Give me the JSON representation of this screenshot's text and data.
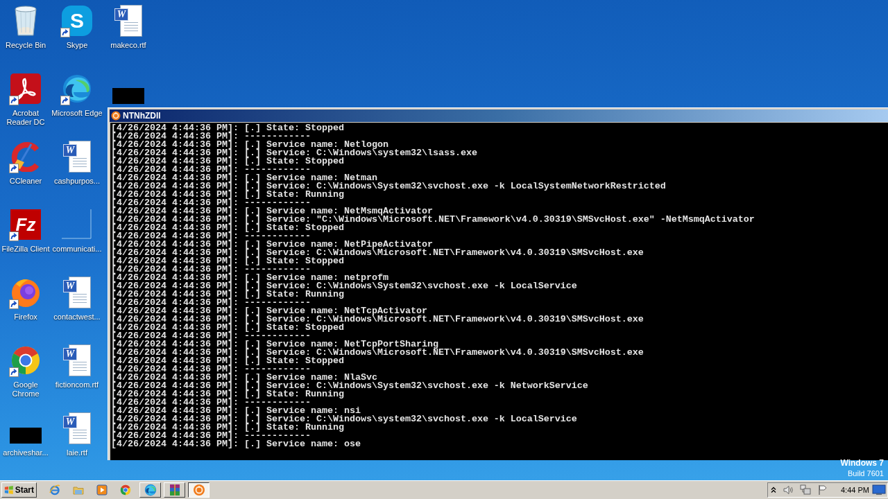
{
  "desktop": {
    "icon_columns": [
      [
        {
          "kind": "recycle-bin",
          "label": "Recycle Bin",
          "shortcut": false
        },
        {
          "kind": "acrobat",
          "label": "Acrobat Reader DC",
          "shortcut": true
        },
        {
          "kind": "ccleaner",
          "label": "CCleaner",
          "shortcut": true
        },
        {
          "kind": "filezilla",
          "label": "FileZilla Client",
          "logo_text": "Fz",
          "shortcut": true
        },
        {
          "kind": "firefox",
          "label": "Firefox",
          "shortcut": true
        },
        {
          "kind": "chrome",
          "label": "Google Chrome",
          "shortcut": true
        },
        {
          "kind": "redacted",
          "label": "archiveshar...",
          "shortcut": false
        }
      ],
      [
        {
          "kind": "skype",
          "label": "Skype",
          "logo_text": "S",
          "shortcut": true
        },
        {
          "kind": "edge",
          "label": "Microsoft Edge",
          "shortcut": true
        },
        {
          "kind": "word",
          "label": "cashpurpos...",
          "logo_text": "W",
          "shortcut": false
        },
        {
          "kind": "blank",
          "label": "communicati...",
          "shortcut": false
        },
        {
          "kind": "word",
          "label": "contactwest...",
          "logo_text": "W",
          "shortcut": false
        },
        {
          "kind": "word",
          "label": "fictioncom.rtf",
          "logo_text": "W",
          "shortcut": false
        },
        {
          "kind": "word",
          "label": "laie.rtf",
          "logo_text": "W",
          "shortcut": false
        }
      ],
      [
        {
          "kind": "word",
          "label": "makeco.rtf",
          "logo_text": "W",
          "shortcut": false
        },
        {
          "kind": "redacted",
          "shortcut": false
        }
      ]
    ],
    "os_edition": "Windows 7",
    "os_build": "Build 7601"
  },
  "console_window": {
    "title": "NTNhZDll",
    "lines": [
      "[4/26/2024 4:44:36 PM]: [.] State: Stopped",
      "[4/26/2024 4:44:36 PM]: ------------",
      "[4/26/2024 4:44:36 PM]: [.] Service name: Netlogon",
      "[4/26/2024 4:44:36 PM]: [.] Service: C:\\Windows\\system32\\lsass.exe",
      "[4/26/2024 4:44:36 PM]: [.] State: Stopped",
      "[4/26/2024 4:44:36 PM]: ------------",
      "[4/26/2024 4:44:36 PM]: [.] Service name: Netman",
      "[4/26/2024 4:44:36 PM]: [.] Service: C:\\Windows\\System32\\svchost.exe -k LocalSystemNetworkRestricted",
      "[4/26/2024 4:44:36 PM]: [.] State: Running",
      "[4/26/2024 4:44:36 PM]: ------------",
      "[4/26/2024 4:44:36 PM]: [.] Service name: NetMsmqActivator",
      "[4/26/2024 4:44:36 PM]: [.] Service: \"C:\\Windows\\Microsoft.NET\\Framework\\v4.0.30319\\SMSvcHost.exe\" -NetMsmqActivator",
      "[4/26/2024 4:44:36 PM]: [.] State: Stopped",
      "[4/26/2024 4:44:36 PM]: ------------",
      "[4/26/2024 4:44:36 PM]: [.] Service name: NetPipeActivator",
      "[4/26/2024 4:44:36 PM]: [.] Service: C:\\Windows\\Microsoft.NET\\Framework\\v4.0.30319\\SMSvcHost.exe",
      "[4/26/2024 4:44:36 PM]: [.] State: Stopped",
      "[4/26/2024 4:44:36 PM]: ------------",
      "[4/26/2024 4:44:36 PM]: [.] Service name: netprofm",
      "[4/26/2024 4:44:36 PM]: [.] Service: C:\\Windows\\System32\\svchost.exe -k LocalService",
      "[4/26/2024 4:44:36 PM]: [.] State: Running",
      "[4/26/2024 4:44:36 PM]: ------------",
      "[4/26/2024 4:44:36 PM]: [.] Service name: NetTcpActivator",
      "[4/26/2024 4:44:36 PM]: [.] Service: C:\\Windows\\Microsoft.NET\\Framework\\v4.0.30319\\SMSvcHost.exe",
      "[4/26/2024 4:44:36 PM]: [.] State: Stopped",
      "[4/26/2024 4:44:36 PM]: ------------",
      "[4/26/2024 4:44:36 PM]: [.] Service name: NetTcpPortSharing",
      "[4/26/2024 4:44:36 PM]: [.] Service: C:\\Windows\\Microsoft.NET\\Framework\\v4.0.30319\\SMSvcHost.exe",
      "[4/26/2024 4:44:36 PM]: [.] State: Stopped",
      "[4/26/2024 4:44:36 PM]: ------------",
      "[4/26/2024 4:44:36 PM]: [.] Service name: NlaSvc",
      "[4/26/2024 4:44:36 PM]: [.] Service: C:\\Windows\\System32\\svchost.exe -k NetworkService",
      "[4/26/2024 4:44:36 PM]: [.] State: Running",
      "[4/26/2024 4:44:36 PM]: ------------",
      "[4/26/2024 4:44:36 PM]: [.] Service name: nsi",
      "[4/26/2024 4:44:36 PM]: [.] Service: C:\\Windows\\system32\\svchost.exe -k LocalService",
      "[4/26/2024 4:44:36 PM]: [.] State: Running",
      "[4/26/2024 4:44:36 PM]: ------------",
      "[4/26/2024 4:44:36 PM]: [.] Service name: ose"
    ]
  },
  "taskbar": {
    "start_label": "Start",
    "quick_launch": [
      {
        "kind": "ie"
      },
      {
        "kind": "explorer"
      },
      {
        "kind": "media"
      },
      {
        "kind": "chrome"
      }
    ],
    "buttons": [
      {
        "kind": "edge",
        "selected": false
      },
      {
        "kind": "winrar",
        "selected": false
      },
      {
        "kind": "app",
        "selected": true
      }
    ],
    "tray": {
      "icons": [
        {
          "kind": "chevron"
        },
        {
          "kind": "speaker"
        },
        {
          "kind": "network"
        },
        {
          "kind": "flag"
        }
      ],
      "clock": "4:44 PM"
    }
  }
}
